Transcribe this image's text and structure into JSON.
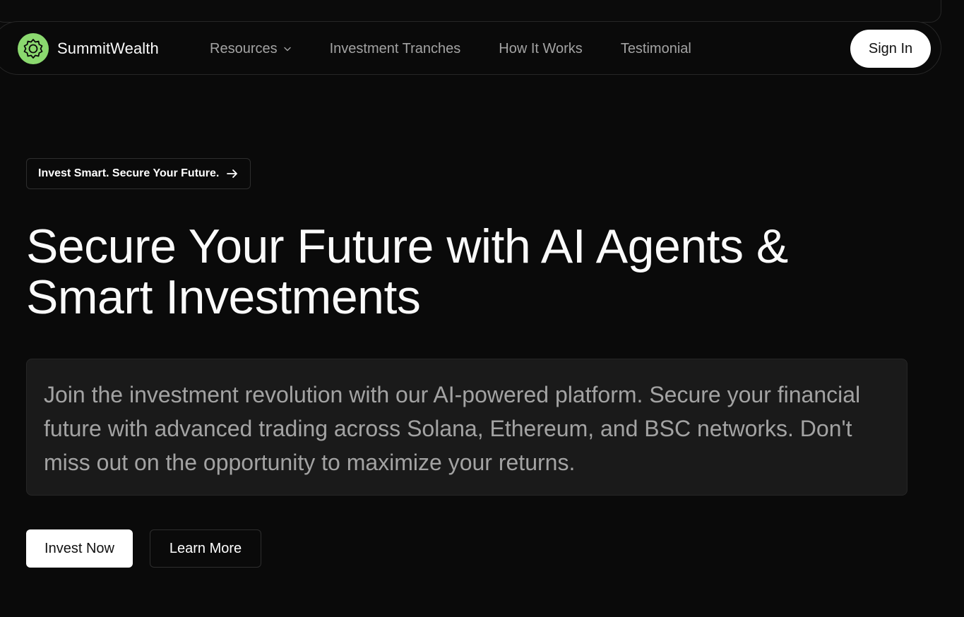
{
  "brand": {
    "name": "SummitWealth",
    "logo_icon": "badge-seal-icon",
    "logo_color": "#8bd96f"
  },
  "nav": {
    "items": [
      {
        "label": "Resources",
        "has_dropdown": true
      },
      {
        "label": "Investment Tranches"
      },
      {
        "label": "How It Works"
      },
      {
        "label": "Testimonial"
      }
    ],
    "signin_label": "Sign In"
  },
  "hero": {
    "badge_label": "Invest Smart. Secure Your Future.",
    "badge_icon": "arrow-right-icon",
    "title_line1": "Secure Your Future with AI Agents &",
    "title_line2": "Smart Investments",
    "description": "Join the investment revolution with our AI-powered platform. Secure your financial future with advanced trading across Solana, Ethereum, and BSC networks. Don't miss out on the opportunity to maximize your returns.",
    "primary_cta": "Invest Now",
    "secondary_cta": "Learn More"
  },
  "colors": {
    "background": "#0a0a0a",
    "panel": "#1a1a1a",
    "border": "#262626",
    "muted_text": "#a3a3a3",
    "accent": "#8bd96f"
  }
}
